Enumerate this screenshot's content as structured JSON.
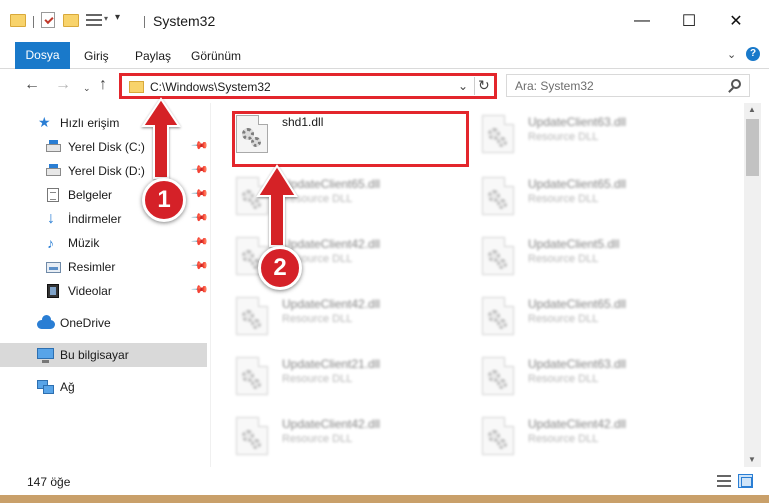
{
  "window": {
    "title": "System32",
    "minimize": "—",
    "maximize": "☐",
    "close": "✕"
  },
  "quick_access": {
    "more": "▾"
  },
  "ribbon": {
    "tabs": [
      "Dosya",
      "Giriş",
      "Paylaş",
      "Görünüm"
    ],
    "expand": "⌄",
    "help": "?"
  },
  "navigation": {
    "back": "←",
    "forward": "→",
    "recent": "⌄",
    "up": "↑",
    "address": "C:\\Windows\\System32",
    "address_dropdown": "⌄",
    "refresh": "↻",
    "search_placeholder": "Ara: System32"
  },
  "sidebar": {
    "items": [
      {
        "label": "Hızlı erişim",
        "icon": "star-icon"
      },
      {
        "label": "Yerel Disk (C:)",
        "icon": "drive-icon",
        "pinned": true
      },
      {
        "label": "Yerel Disk (D:)",
        "icon": "drive-icon",
        "pinned": true
      },
      {
        "label": "Belgeler",
        "icon": "documents-icon",
        "pinned": true
      },
      {
        "label": "İndirmeler",
        "icon": "download-icon",
        "pinned": true
      },
      {
        "label": "Müzik",
        "icon": "music-icon",
        "pinned": true
      },
      {
        "label": "Resimler",
        "icon": "pictures-icon",
        "pinned": true
      },
      {
        "label": "Videolar",
        "icon": "videos-icon",
        "pinned": true
      },
      {
        "label": "OneDrive",
        "icon": "onedrive-icon"
      },
      {
        "label": "Bu bilgisayar",
        "icon": "this-pc-icon",
        "selected": true
      },
      {
        "label": "Ağ",
        "icon": "network-icon"
      }
    ],
    "pin_glyph": "📌"
  },
  "files": [
    {
      "name": "shd1.dll",
      "type": "",
      "highlighted": true
    },
    {
      "name": "UpdateClient63.dll",
      "type": "Resource DLL"
    },
    {
      "name": "UpdateClient65.dll",
      "type": "Resource DLL"
    },
    {
      "name": "UpdateClient65.dll",
      "type": "Resource DLL"
    },
    {
      "name": "UpdateClient42.dll",
      "type": "Resource DLL"
    },
    {
      "name": "UpdateClient5.dll",
      "type": "Resource DLL"
    },
    {
      "name": "UpdateClient42.dll",
      "type": "Resource DLL"
    },
    {
      "name": "UpdateClient65.dll",
      "type": "Resource DLL"
    },
    {
      "name": "UpdateClient21.dll",
      "type": "Resource DLL"
    },
    {
      "name": "UpdateClient63.dll",
      "type": "Resource DLL"
    },
    {
      "name": "UpdateClient42.dll",
      "type": "Resource DLL"
    },
    {
      "name": "UpdateClient42.dll",
      "type": "Resource DLL"
    }
  ],
  "scrollbar": {
    "up": "▲",
    "down": "▼"
  },
  "status": {
    "item_count": "147 öğe"
  },
  "callouts": [
    "1",
    "2"
  ],
  "colors": {
    "accent": "#1979ca",
    "highlight_red": "#e3262c",
    "callout_red": "#d52128",
    "selected_bg": "#d9d9d9"
  }
}
